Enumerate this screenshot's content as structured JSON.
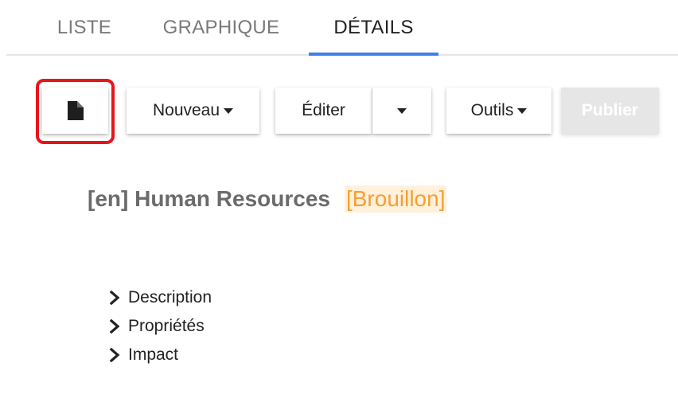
{
  "tabs": [
    {
      "label": "LISTE",
      "active": false
    },
    {
      "label": "GRAPHIQUE",
      "active": false
    },
    {
      "label": "DÉTAILS",
      "active": true
    }
  ],
  "toolbar": {
    "document_icon": "document-icon",
    "new_label": "Nouveau",
    "edit_label": "Éditer",
    "tools_label": "Outils",
    "publish_label": "Publier",
    "highlight_color": "#e8141b"
  },
  "page": {
    "title": "[en] Human Resources",
    "status": "[Brouillon]"
  },
  "sections": [
    {
      "label": "Description"
    },
    {
      "label": "Propriétés"
    },
    {
      "label": "Impact"
    }
  ],
  "colors": {
    "active_tab_underline": "#3f7fe8",
    "status_text": "#f5a035",
    "status_background": "#fff1dc",
    "disabled_button": "#e6e6e6"
  }
}
